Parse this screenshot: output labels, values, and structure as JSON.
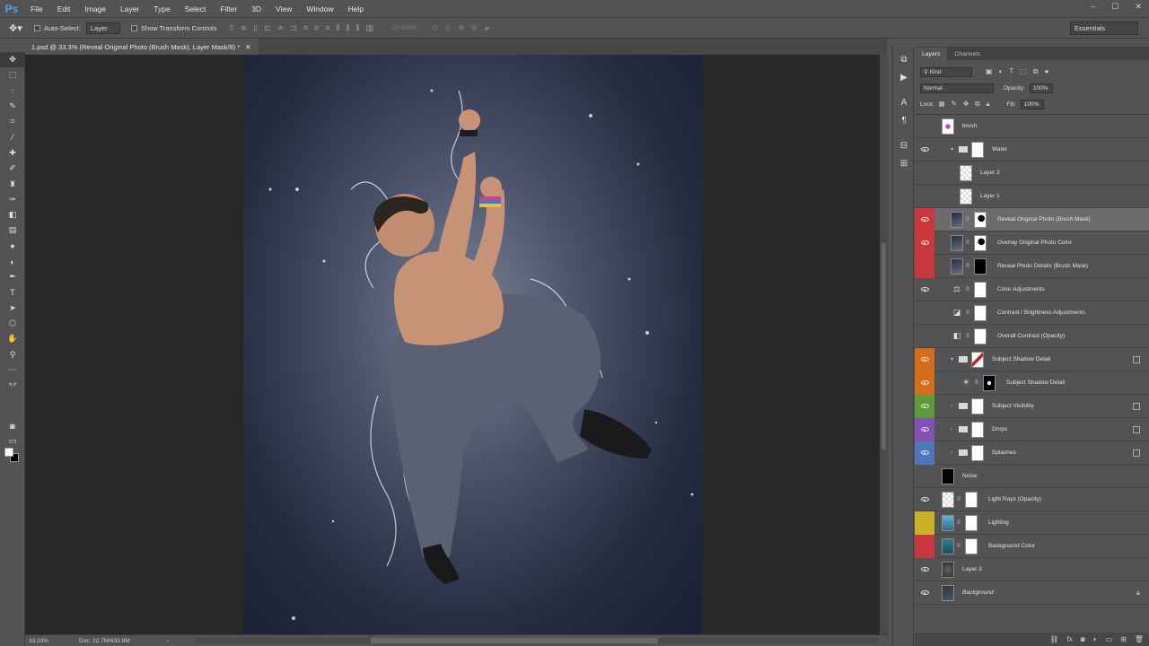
{
  "app": {
    "logo": "Ps"
  },
  "menu": [
    "File",
    "Edit",
    "Image",
    "Layer",
    "Type",
    "Select",
    "Filter",
    "3D",
    "View",
    "Window",
    "Help"
  ],
  "window_controls": [
    "–",
    "☐",
    "✕"
  ],
  "options_bar": {
    "auto_select_label": "Auto-Select:",
    "auto_select_value": "Layer",
    "show_transform_label": "Show Transform Controls",
    "mode_3d_label": "3D Mode:",
    "workspace": "Essentials"
  },
  "document_tab": {
    "title": "1.psd @ 33.3% (Reveal Original Photo (Brush Mask), Layer Mask/8) *",
    "close": "✕"
  },
  "status": {
    "zoom": "33.33%",
    "doc_size": "Doc: 22.7M/633.8M"
  },
  "panel": {
    "tabs": [
      "Layers",
      "Channels"
    ],
    "filter_kind": "Kind",
    "blend_mode": "Normal",
    "opacity_label": "Opacity:",
    "opacity_value": "100%",
    "lock_label": "Lock:",
    "fill_label": "Fill:",
    "fill_value": "100%"
  },
  "layers": [
    {
      "name": "brush",
      "visible": false,
      "tag": "",
      "thumb": "brush",
      "selected": false
    },
    {
      "name": "Water",
      "visible": true,
      "tag": "",
      "thumb": "folder",
      "selected": false
    },
    {
      "name": "Layer 2",
      "visible": false,
      "tag": "",
      "thumb": "checker",
      "selected": false
    },
    {
      "name": "Layer 1",
      "visible": false,
      "tag": "",
      "thumb": "checker",
      "selected": false
    },
    {
      "name": "Reveal Original Photo (Brush Mask)",
      "visible": true,
      "tag": "#c8383c",
      "thumb": "photo",
      "mask": "partial",
      "selected": true
    },
    {
      "name": "Overlay Original Photo Color",
      "visible": true,
      "tag": "#c8383c",
      "thumb": "photo",
      "mask": "partial",
      "selected": false
    },
    {
      "name": "Reveal Photo Details (Brush Mask)",
      "visible": false,
      "tag": "#c8383c",
      "thumb": "photo",
      "mask": "black",
      "selected": false
    },
    {
      "name": "Color Adjustments",
      "visible": true,
      "tag": "",
      "thumb": "adjust-balance",
      "mask": "white",
      "selected": false
    },
    {
      "name": "Contrast / Brightness Adjustments",
      "visible": false,
      "tag": "",
      "thumb": "adjust-curves",
      "mask": "white",
      "selected": false
    },
    {
      "name": "Overall Contrast (Opacity)",
      "visible": false,
      "tag": "",
      "thumb": "adjust-levels",
      "mask": "white",
      "selected": false
    },
    {
      "name": "Subject Shadow Detail",
      "visible": true,
      "tag": "#d36f1c",
      "thumb": "group-red",
      "selected": false
    },
    {
      "name": "Subject Shadow Detail",
      "visible": true,
      "tag": "#d36f1c",
      "thumb": "adjust-sun",
      "mask": "dark-silhouette",
      "selected": false
    },
    {
      "name": "Subject Visibility",
      "visible": true,
      "tag": "#5f9b3c",
      "thumb": "folder",
      "selected": false
    },
    {
      "name": "Drops",
      "visible": true,
      "tag": "#8152b5",
      "thumb": "folder",
      "selected": false
    },
    {
      "name": "Splashes",
      "visible": true,
      "tag": "#4e78b8",
      "thumb": "folder",
      "selected": false
    },
    {
      "name": "Noise",
      "visible": false,
      "tag": "",
      "thumb": "black",
      "selected": false
    },
    {
      "name": "Light Rays (Opacity)",
      "visible": true,
      "tag": "",
      "thumb": "checker",
      "mask": "white",
      "selected": false
    },
    {
      "name": "Lighting",
      "visible": false,
      "tag": "#c9b227",
      "thumb": "teal",
      "mask": "white",
      "selected": false
    },
    {
      "name": "Background Color",
      "visible": false,
      "tag": "#c8383c",
      "thumb": "teal2",
      "mask": "white",
      "selected": false
    },
    {
      "name": "Layer 3",
      "visible": true,
      "tag": "",
      "thumb": "dark",
      "selected": false
    },
    {
      "name": "Background",
      "visible": true,
      "tag": "",
      "thumb": "bg",
      "selected": false
    }
  ]
}
